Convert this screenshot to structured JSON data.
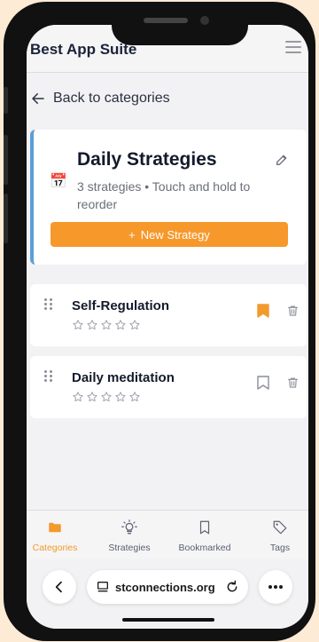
{
  "header": {
    "title": "Best App Suite"
  },
  "nav": {
    "back_label": "Back to categories"
  },
  "category": {
    "emoji": "📅",
    "title": "Daily Strategies",
    "description": "3 strategies • Touch and hold to reorder",
    "new_button_label": "New Strategy"
  },
  "strategies": [
    {
      "name": "Self-Regulation",
      "rating": 0,
      "bookmarked": true
    },
    {
      "name": "Daily meditation",
      "rating": 0,
      "bookmarked": false
    }
  ],
  "tabs": [
    {
      "label": "Categories",
      "icon": "folder-icon",
      "active": true
    },
    {
      "label": "Strategies",
      "icon": "lightbulb-icon",
      "active": false
    },
    {
      "label": "Bookmarked",
      "icon": "bookmark-icon",
      "active": false
    },
    {
      "label": "Tags",
      "icon": "tag-icon",
      "active": false
    }
  ],
  "browser": {
    "url": "stconnections.org"
  },
  "colors": {
    "accent": "#f7982b",
    "category_border": "#5b9fd6",
    "bookmark_active": "#f39a2c"
  }
}
